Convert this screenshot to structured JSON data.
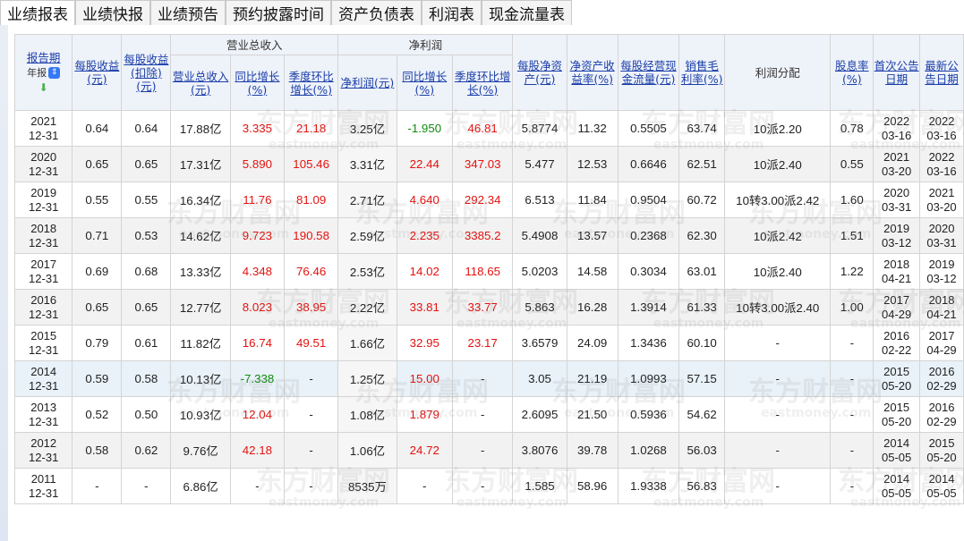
{
  "tabs": [
    "业绩报表",
    "业绩快报",
    "业绩预告",
    "预约披露时间",
    "资产负债表",
    "利润表",
    "现金流量表"
  ],
  "headers": {
    "report_period": "报告期",
    "period_select_value": "年报",
    "eps": "每股收益(元)",
    "eps_deducted": "每股收益(扣除)(元)",
    "revenue_group": "营业总收入",
    "revenue": "营业总收入(元)",
    "revenue_yoy": "同比增长(%)",
    "revenue_qoq": "季度环比增长(%)",
    "profit_group": "净利润",
    "net_profit": "净利润(元)",
    "profit_yoy": "同比增长(%)",
    "profit_qoq": "季度环比增长(%)",
    "bvps": "每股净资产(元)",
    "roe": "净资产收益率(%)",
    "ocfps": "每股经营现金流量(元)",
    "gross_margin": "销售毛利率(%)",
    "dividend_plan": "利润分配",
    "dividend_yield": "股息率(%)",
    "first_announce": "首次公告日期",
    "latest_announce": "最新公告日期"
  },
  "watermark": {
    "text_cn": "东方财富网",
    "text_en": "eastmoney.com"
  },
  "colors": {
    "up": "#e4120f",
    "down": "#0f8a0f",
    "link": "#1a3ea8",
    "header_bg": "#eef2f9",
    "highlight_row": "#e8f2f8"
  },
  "rows": [
    {
      "period": [
        "2021",
        "12-31"
      ],
      "eps": "0.64",
      "eps_d": "0.64",
      "rev": "17.88亿",
      "rev_yoy": "3.335",
      "rev_qoq": "21.18",
      "np": "3.25亿",
      "np_yoy": "-1.950",
      "np_qoq": "46.81",
      "bvps": "5.8774",
      "roe": "11.32",
      "ocfps": "0.5505",
      "gm": "63.74",
      "div": "10派2.20",
      "dy": "0.78",
      "first": [
        "2022",
        "03-16"
      ],
      "latest": [
        "2022",
        "03-16"
      ]
    },
    {
      "period": [
        "2020",
        "12-31"
      ],
      "eps": "0.65",
      "eps_d": "0.65",
      "rev": "17.31亿",
      "rev_yoy": "5.890",
      "rev_qoq": "105.46",
      "np": "3.31亿",
      "np_yoy": "22.44",
      "np_qoq": "347.03",
      "bvps": "5.477",
      "roe": "12.53",
      "ocfps": "0.6646",
      "gm": "62.51",
      "div": "10派2.40",
      "dy": "0.55",
      "first": [
        "2021",
        "03-20"
      ],
      "latest": [
        "2022",
        "03-16"
      ]
    },
    {
      "period": [
        "2019",
        "12-31"
      ],
      "eps": "0.55",
      "eps_d": "0.55",
      "rev": "16.34亿",
      "rev_yoy": "11.76",
      "rev_qoq": "81.09",
      "np": "2.71亿",
      "np_yoy": "4.640",
      "np_qoq": "292.34",
      "bvps": "6.513",
      "roe": "11.84",
      "ocfps": "0.9504",
      "gm": "60.72",
      "div": "10转3.00派2.42",
      "dy": "1.60",
      "first": [
        "2020",
        "03-31"
      ],
      "latest": [
        "2021",
        "03-20"
      ]
    },
    {
      "period": [
        "2018",
        "12-31"
      ],
      "eps": "0.71",
      "eps_d": "0.53",
      "rev": "14.62亿",
      "rev_yoy": "9.723",
      "rev_qoq": "190.58",
      "np": "2.59亿",
      "np_yoy": "2.235",
      "np_qoq": "3385.2",
      "bvps": "5.4908",
      "roe": "13.57",
      "ocfps": "0.2368",
      "gm": "62.30",
      "div": "10派2.42",
      "dy": "1.51",
      "first": [
        "2019",
        "03-12"
      ],
      "latest": [
        "2020",
        "03-31"
      ]
    },
    {
      "period": [
        "2017",
        "12-31"
      ],
      "eps": "0.69",
      "eps_d": "0.68",
      "rev": "13.33亿",
      "rev_yoy": "4.348",
      "rev_qoq": "76.46",
      "np": "2.53亿",
      "np_yoy": "14.02",
      "np_qoq": "118.65",
      "bvps": "5.0203",
      "roe": "14.58",
      "ocfps": "0.3034",
      "gm": "63.01",
      "div": "10派2.40",
      "dy": "1.22",
      "first": [
        "2018",
        "04-21"
      ],
      "latest": [
        "2019",
        "03-12"
      ]
    },
    {
      "period": [
        "2016",
        "12-31"
      ],
      "eps": "0.65",
      "eps_d": "0.65",
      "rev": "12.77亿",
      "rev_yoy": "8.023",
      "rev_qoq": "38.95",
      "np": "2.22亿",
      "np_yoy": "33.81",
      "np_qoq": "33.77",
      "bvps": "5.863",
      "roe": "16.28",
      "ocfps": "1.3914",
      "gm": "61.33",
      "div": "10转3.00派2.40",
      "dy": "1.00",
      "first": [
        "2017",
        "04-29"
      ],
      "latest": [
        "2018",
        "04-21"
      ]
    },
    {
      "period": [
        "2015",
        "12-31"
      ],
      "eps": "0.79",
      "eps_d": "0.61",
      "rev": "11.82亿",
      "rev_yoy": "16.74",
      "rev_qoq": "49.51",
      "np": "1.66亿",
      "np_yoy": "32.95",
      "np_qoq": "23.17",
      "bvps": "3.6579",
      "roe": "24.09",
      "ocfps": "1.3436",
      "gm": "60.10",
      "div": "-",
      "dy": "-",
      "first": [
        "2016",
        "02-22"
      ],
      "latest": [
        "2017",
        "04-29"
      ]
    },
    {
      "period": [
        "2014",
        "12-31"
      ],
      "eps": "0.59",
      "eps_d": "0.58",
      "rev": "10.13亿",
      "rev_yoy": "-7.338",
      "rev_qoq": "-",
      "np": "1.25亿",
      "np_yoy": "15.00",
      "np_qoq": "-",
      "bvps": "3.05",
      "roe": "21.19",
      "ocfps": "1.0993",
      "gm": "57.15",
      "div": "-",
      "dy": "-",
      "first": [
        "2015",
        "05-20"
      ],
      "latest": [
        "2016",
        "02-29"
      ]
    },
    {
      "period": [
        "2013",
        "12-31"
      ],
      "eps": "0.52",
      "eps_d": "0.50",
      "rev": "10.93亿",
      "rev_yoy": "12.04",
      "rev_qoq": "-",
      "np": "1.08亿",
      "np_yoy": "1.879",
      "np_qoq": "-",
      "bvps": "2.6095",
      "roe": "21.50",
      "ocfps": "0.5936",
      "gm": "54.62",
      "div": "-",
      "dy": "-",
      "first": [
        "2015",
        "05-20"
      ],
      "latest": [
        "2016",
        "02-29"
      ]
    },
    {
      "period": [
        "2012",
        "12-31"
      ],
      "eps": "0.58",
      "eps_d": "0.62",
      "rev": "9.76亿",
      "rev_yoy": "42.18",
      "rev_qoq": "-",
      "np": "1.06亿",
      "np_yoy": "24.72",
      "np_qoq": "-",
      "bvps": "3.8076",
      "roe": "39.78",
      "ocfps": "1.0268",
      "gm": "56.03",
      "div": "-",
      "dy": "-",
      "first": [
        "2014",
        "05-05"
      ],
      "latest": [
        "2015",
        "05-20"
      ]
    },
    {
      "period": [
        "2011",
        "12-31"
      ],
      "eps": "-",
      "eps_d": "-",
      "rev": "6.86亿",
      "rev_yoy": "-",
      "rev_qoq": "-",
      "np": "8535万",
      "np_yoy": "-",
      "np_qoq": "-",
      "bvps": "1.585",
      "roe": "58.96",
      "ocfps": "1.9338",
      "gm": "56.83",
      "div": "-",
      "dy": "-",
      "first": [
        "2014",
        "05-05"
      ],
      "latest": [
        "2014",
        "05-05"
      ]
    }
  ]
}
